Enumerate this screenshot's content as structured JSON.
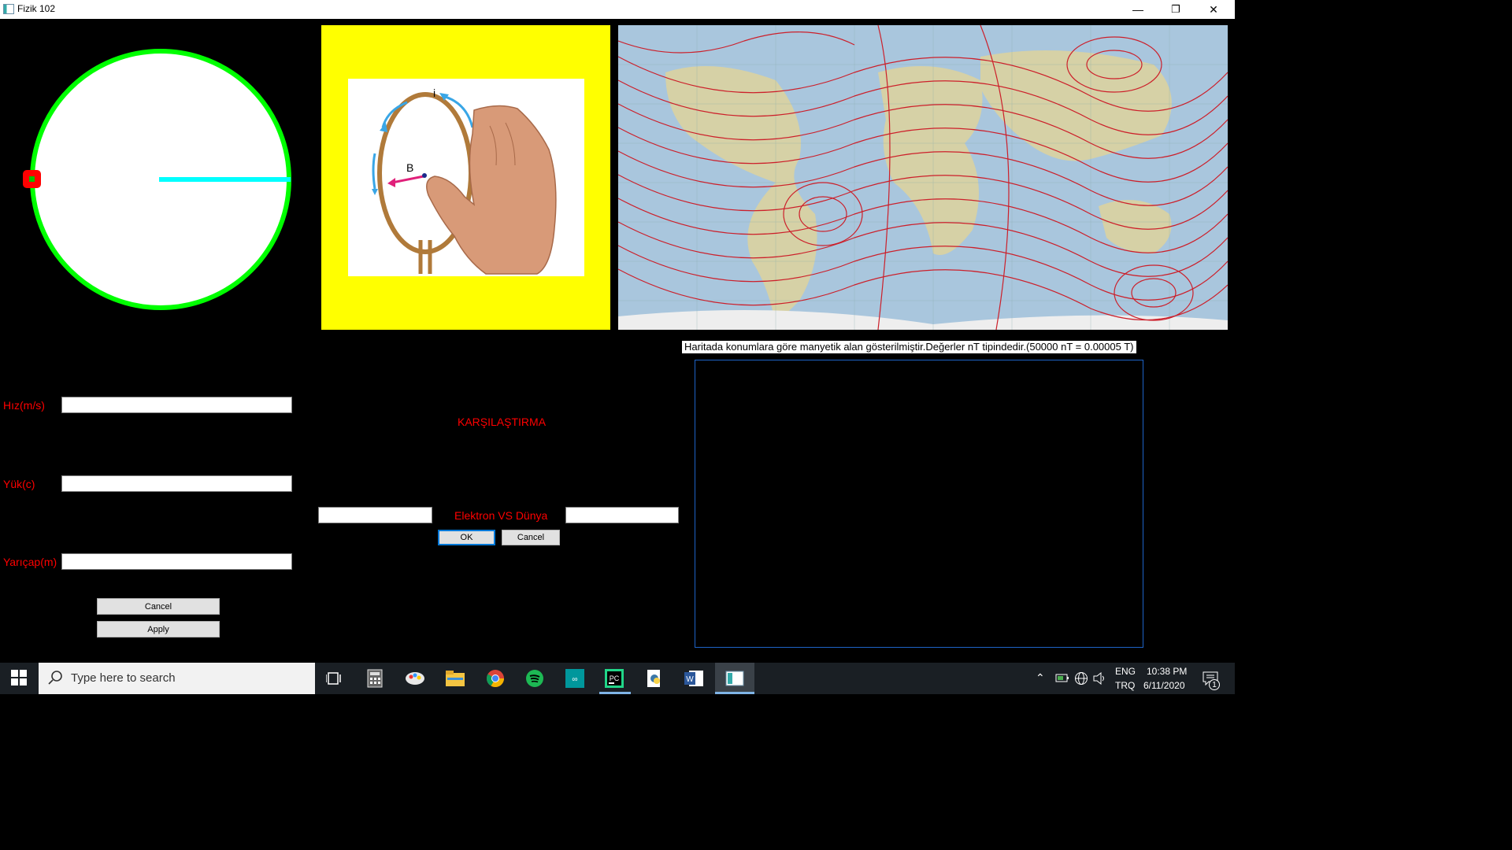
{
  "window": {
    "title": "Fizik 102",
    "minimize_glyph": "—",
    "restore_glyph": "❐",
    "close_glyph": "✕"
  },
  "map": {
    "caption": "Haritada konumlara göre manyetik alan gösterilmiştir.Değerler nT tipindedir.(50000 nT = 0.00005 T)"
  },
  "hand_figure": {
    "current_label": "i",
    "field_label": "B"
  },
  "form": {
    "speed_label": "Hız(m/s)",
    "charge_label": "Yük(c)",
    "radius_label": "Yarıçap(m)",
    "speed_value": "",
    "charge_value": "",
    "radius_value": "",
    "cancel_label": "Cancel",
    "apply_label": "Apply"
  },
  "comparison": {
    "title": "KARŞILAŞTIRMA",
    "label": "Elektron VS Dünya",
    "left_value": "",
    "right_value": "",
    "ok_label": "OK",
    "cancel_label": "Cancel"
  },
  "taskbar": {
    "search_placeholder": "Type here to search",
    "lang_top": "ENG",
    "lang_bottom": "TRQ",
    "time": "10:38 PM",
    "date": "6/11/2020",
    "notification_count": "1"
  },
  "colors": {
    "circle_stroke": "#00ff00",
    "radius_line": "#00ffff",
    "marker": "#ff0000",
    "panel_bg": "#ffff00",
    "label_red": "#ff0000"
  }
}
